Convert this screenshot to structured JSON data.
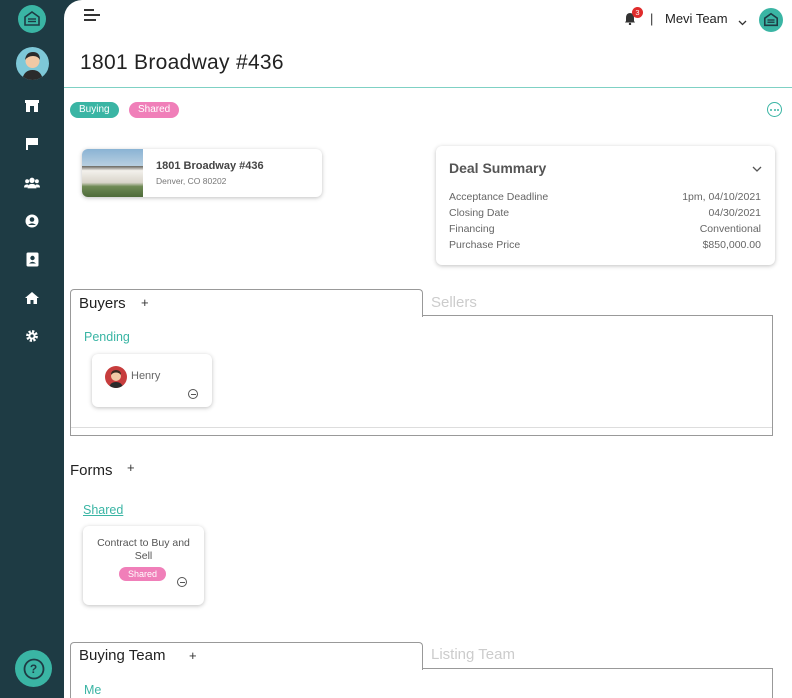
{
  "header": {
    "notifications_count": "3",
    "separator": "|",
    "team_name": "Mevi Team"
  },
  "page": {
    "title": "1801 Broadway #436"
  },
  "tags": {
    "buying": "Buying",
    "shared": "Shared"
  },
  "property": {
    "name": "1801 Broadway #436",
    "address": "Denver,  CO  80202"
  },
  "deal_summary": {
    "title": "Deal Summary",
    "rows": [
      {
        "label": "Acceptance Deadline",
        "value": "1pm, 04/10/2021"
      },
      {
        "label": "Closing Date",
        "value": "04/30/2021"
      },
      {
        "label": "Financing",
        "value": "Conventional"
      },
      {
        "label": "Purchase Price",
        "value": "$850,000.00"
      }
    ]
  },
  "parties": {
    "tab_buyers": "Buyers",
    "tab_sellers": "Sellers",
    "add": "+",
    "status_label": "Pending",
    "buyer_name": "Henry"
  },
  "forms": {
    "title": "Forms",
    "add": "+",
    "shared_label": "Shared",
    "card_name": "Contract to Buy and Sell",
    "card_tag": "Shared"
  },
  "team": {
    "tab_buying": "Buying Team",
    "tab_listing": "Listing Team",
    "add": "+",
    "first_member": "Me"
  },
  "help": {
    "label": "?"
  },
  "colors": {
    "accent": "#3ab5a4",
    "sidebar": "#1e3b44",
    "shared_pink": "#f07fb9",
    "badge_red": "#e02b2b"
  },
  "icons": {
    "sidebar": [
      "store-icon",
      "flag-icon",
      "users-icon",
      "user-circle-icon",
      "contact-book-icon",
      "home-icon",
      "gear-icon"
    ]
  }
}
